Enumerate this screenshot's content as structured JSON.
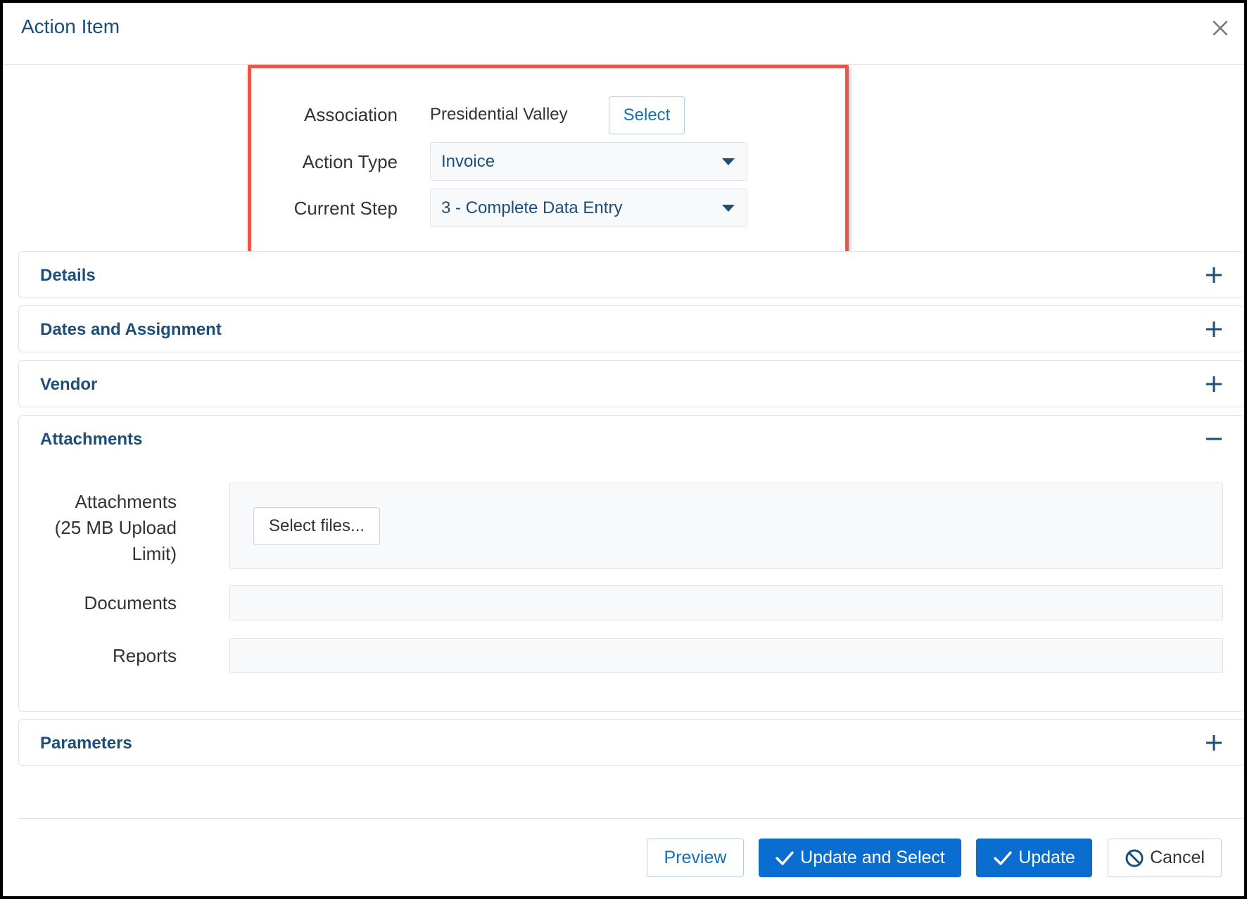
{
  "dialog": {
    "title": "Action Item"
  },
  "header_fields": {
    "association_label": "Association",
    "association_value": "Presidential Valley",
    "select_button": "Select",
    "action_type_label": "Action Type",
    "action_type_value": "Invoice",
    "current_step_label": "Current Step",
    "current_step_value": "3 - Complete Data Entry"
  },
  "panels": {
    "details": {
      "title": "Details",
      "expanded": false
    },
    "dates": {
      "title": "Dates and Assignment",
      "expanded": false
    },
    "vendor": {
      "title": "Vendor",
      "expanded": false
    },
    "attachments": {
      "title": "Attachments",
      "expanded": true,
      "attachments_label_line1": "Attachments",
      "attachments_label_line2": "(25 MB Upload",
      "attachments_label_line3": "Limit)",
      "select_files_button": "Select files...",
      "documents_label": "Documents",
      "reports_label": "Reports"
    },
    "parameters": {
      "title": "Parameters",
      "expanded": false
    }
  },
  "footer": {
    "preview": "Preview",
    "update_and_select": "Update and Select",
    "update": "Update",
    "cancel": "Cancel"
  },
  "colors": {
    "highlight_border": "#e8584a",
    "primary": "#0a6ed1",
    "heading": "#1c4e7a"
  },
  "icons": {
    "close": "close-icon",
    "caret": "caret-down-icon",
    "plus": "plus-icon",
    "minus": "minus-icon",
    "check": "check-icon",
    "ban": "ban-icon"
  }
}
